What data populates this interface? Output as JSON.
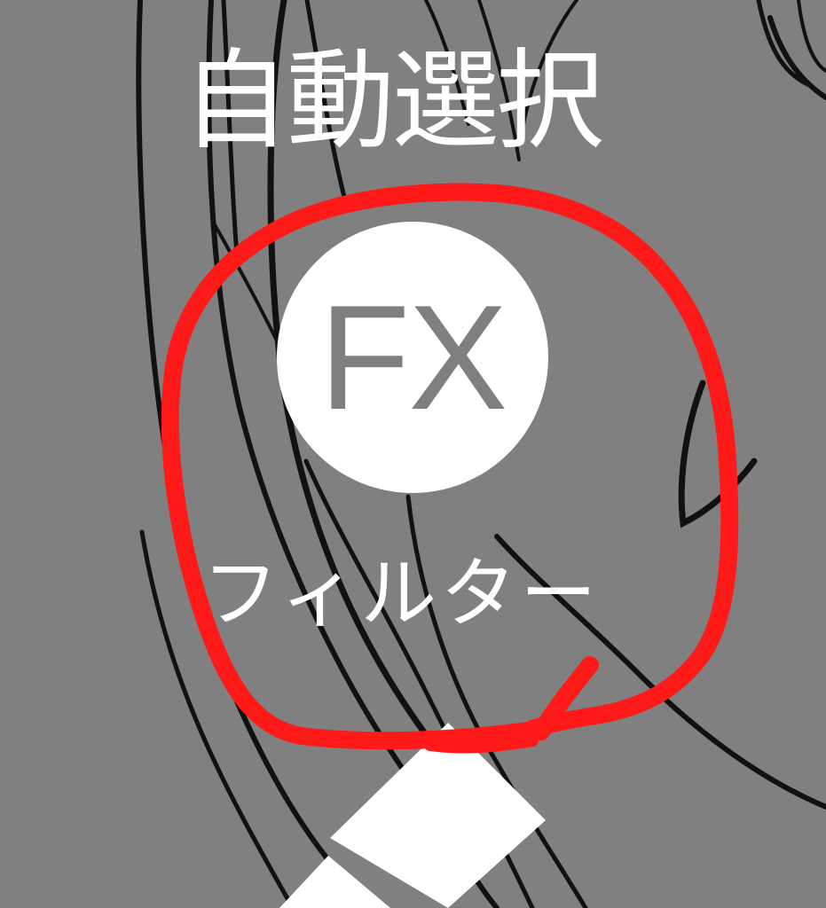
{
  "toolbar": {
    "auto_select_label": "自動選択",
    "fx_icon_text": "FX",
    "filter_label": "フィルター"
  },
  "colors": {
    "background": "#808080",
    "button_fill": "#ffffff",
    "icon_text": "#7f7f7f",
    "annotation": "#ff0000",
    "line_art": "#111111"
  },
  "icons": {
    "fx": "fx-filter-icon",
    "annotation": "red-circle-annotation"
  }
}
